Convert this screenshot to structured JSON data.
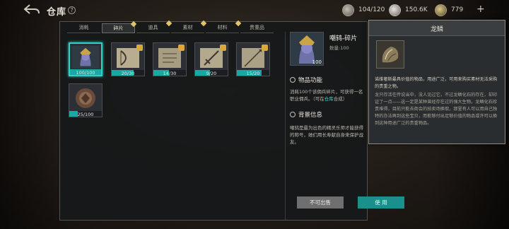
{
  "header": {
    "title": "仓库",
    "help_icon": "question-icon",
    "help_glyph": "?",
    "currencies": [
      {
        "name": "stone-coin-icon",
        "value": "104/120"
      },
      {
        "name": "silver-coin-icon",
        "value": "150.6K"
      },
      {
        "name": "gold-scale-icon",
        "value": "779"
      }
    ],
    "add_glyph": "+"
  },
  "tabs": [
    {
      "label": "消耗",
      "active": false,
      "dot": false
    },
    {
      "label": "碎片",
      "active": true,
      "dot": true
    },
    {
      "label": "道具",
      "active": false,
      "dot": true
    },
    {
      "label": "素材",
      "active": false,
      "dot": true
    },
    {
      "label": "材料",
      "active": false,
      "dot": true
    },
    {
      "label": "贵重品",
      "active": false,
      "dot": false
    }
  ],
  "items": [
    {
      "name": "archer-portrait-fragment",
      "count": "100/100",
      "progress": 1.0,
      "selected": true
    },
    {
      "name": "bow-blueprint-fragment",
      "count": "20/30",
      "progress": 0.67,
      "selected": false
    },
    {
      "name": "scroll-blueprint-fragment",
      "count": "14/30",
      "progress": 0.47,
      "selected": false
    },
    {
      "name": "sword-blueprint-fragment",
      "count": "9/20",
      "progress": 0.45,
      "selected": false
    },
    {
      "name": "spear-blueprint-fragment",
      "count": "15/20",
      "progress": 0.75,
      "selected": false
    },
    {
      "name": "shield-emblem-fragment",
      "count": "25/100",
      "progress": 0.25,
      "selected": false
    }
  ],
  "detail": {
    "count": "100",
    "name": "嘲鸫-碎片",
    "qty_label": "数量:100",
    "func_title": "物品功能",
    "func_text_a": "消耗100个该佣兵碎片，可获得一名",
    "func_text_b": "职业佣兵。（可在",
    "func_link": "仓库",
    "func_text_c": "合成）",
    "bg_title": "背景信息",
    "bg_text": "嘲鸫是最为出色的精灵乐师才能获得的称号，她们用长寿献自身来保护战友。"
  },
  "buttons": {
    "unsellable": "不可出售",
    "use": "使 用"
  },
  "tooltip": {
    "title": "龙鳞",
    "text1": "诺维奢斯最具价值的物品，用途广泛，可用来购买素材无法采购的贵重之物。",
    "text2": "龙只存活在传说当中，没人见过它，不过龙鳞化石的存在，却印证了一点——这一定是某种曾经存在过的强大生物。龙鳞化石珍贵难得，目前只能去商会的拍卖场换取，那里有人可以用自己独特的办法再到这些宝贝，而能够付出足够价值的物品或许可以换到这种用途广泛的贵重物品。"
  },
  "colors": {
    "accent": "#1aa8a5",
    "selected_border": "#2fd0c6",
    "tab_dot": "#e0c46a"
  }
}
